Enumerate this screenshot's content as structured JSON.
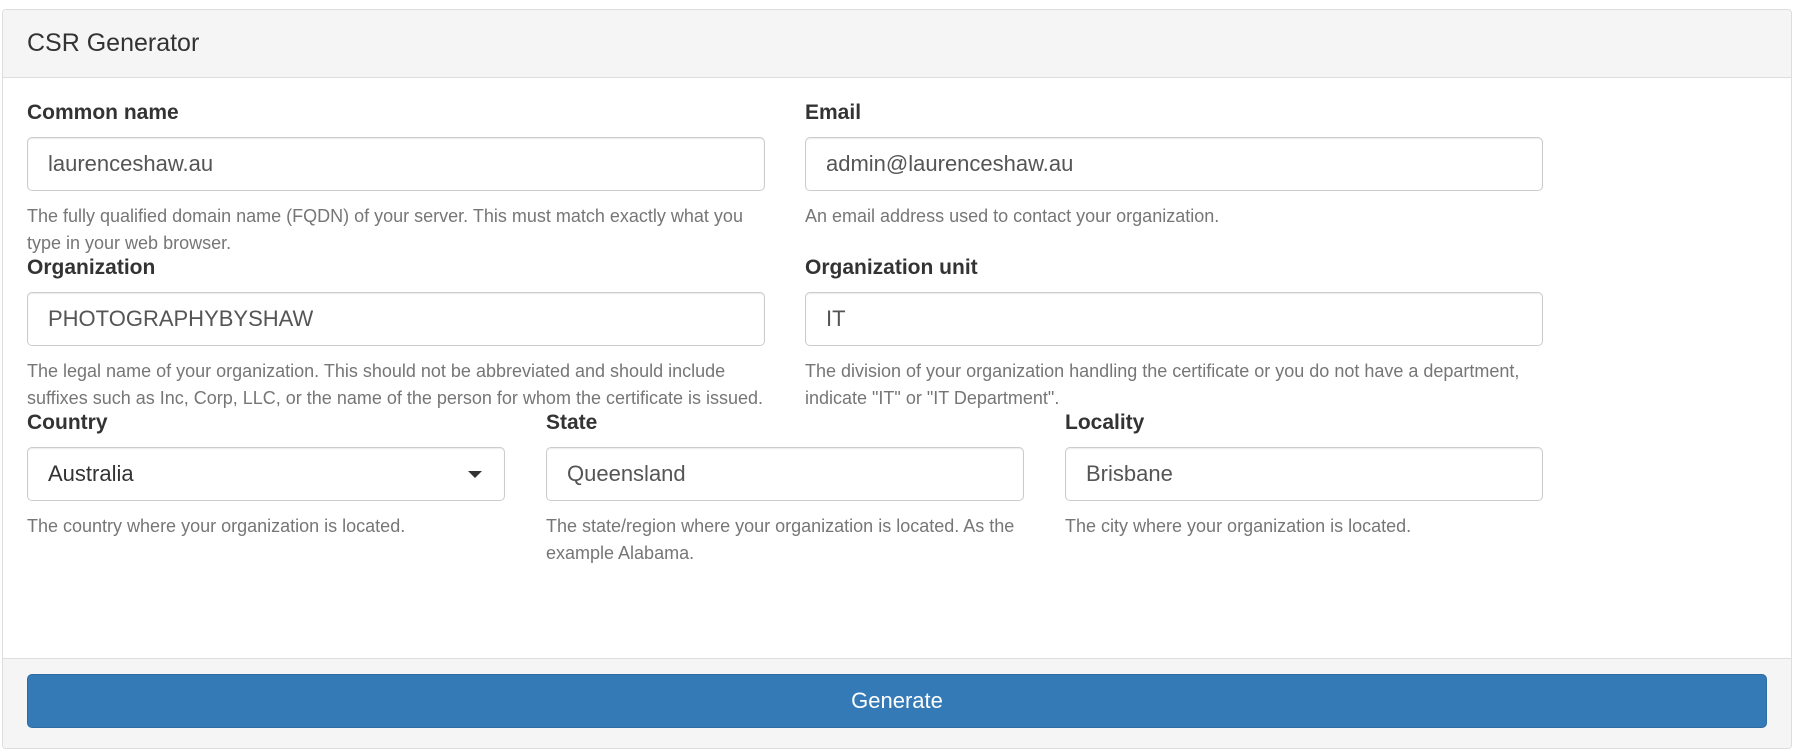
{
  "panel": {
    "title": "CSR Generator"
  },
  "fields": {
    "common_name": {
      "label": "Common name",
      "value": "laurenceshaw.au",
      "help": "The fully qualified domain name (FQDN) of your server. This must match exactly what you type in your web browser."
    },
    "email": {
      "label": "Email",
      "value": "admin@laurenceshaw.au",
      "help": "An email address used to contact your organization."
    },
    "organization": {
      "label": "Organization",
      "value": "PHOTOGRAPHYBYSHAW",
      "help": "The legal name of your organization. This should not be abbreviated and should include suffixes such as Inc, Corp, LLC, or the name of the person for whom the certificate is issued."
    },
    "organization_unit": {
      "label": "Organization unit",
      "value": "IT",
      "help": "The division of your organization handling the certificate or you do not have a department, indicate \"IT\" or \"IT Department\"."
    },
    "country": {
      "label": "Country",
      "selected": "Australia",
      "help": "The country where your organization is located."
    },
    "state": {
      "label": "State",
      "value": "Queensland",
      "help": "The state/region where your organization is located. As the example Alabama."
    },
    "locality": {
      "label": "Locality",
      "value": "Brisbane",
      "help": "The city where your organization is located."
    }
  },
  "footer": {
    "generate_label": "Generate"
  },
  "colors": {
    "primary": "#337ab7",
    "help_text": "#767676",
    "panel_bg": "#f5f5f5"
  },
  "icons": {
    "country_select": "caret-down-icon"
  }
}
